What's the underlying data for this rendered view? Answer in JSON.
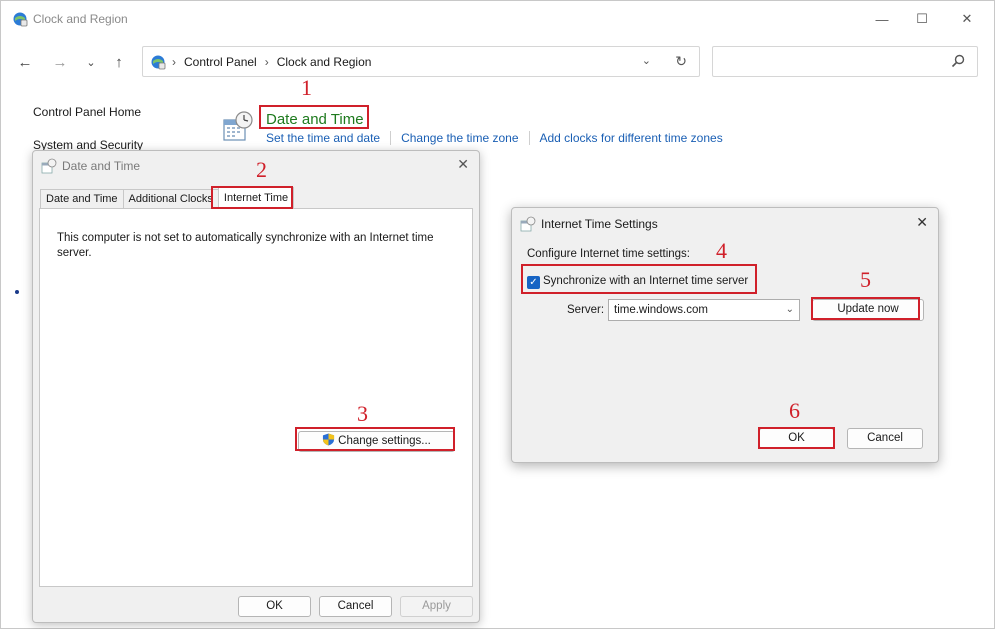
{
  "window": {
    "title": "Clock and Region",
    "controls": {
      "minimize": "—",
      "maximize": "☐",
      "close": "✕"
    }
  },
  "nav": {
    "back": "←",
    "forward": "→",
    "recent": "⌄",
    "up": "↑",
    "breadcrumbs": [
      "Control Panel",
      "Clock and Region"
    ],
    "separator": "›",
    "dropdown": "⌄",
    "refresh": "↻",
    "search_placeholder": ""
  },
  "sidebar": {
    "items": [
      {
        "label": "Control Panel Home"
      },
      {
        "label": "System and Security"
      }
    ]
  },
  "category": {
    "heading": "Date and Time",
    "links": [
      "Set the time and date",
      "Change the time zone",
      "Add clocks for different time zones"
    ]
  },
  "date_time_dialog": {
    "title": "Date and Time",
    "close": "✕",
    "tabs": [
      {
        "label": "Date and Time",
        "active": false
      },
      {
        "label": "Additional Clocks",
        "active": false
      },
      {
        "label": "Internet Time",
        "active": true
      }
    ],
    "message": "This computer is not set to automatically synchronize with an Internet time server.",
    "change_settings_label": "Change settings...",
    "ok_label": "OK",
    "cancel_label": "Cancel",
    "apply_label": "Apply"
  },
  "internet_time_dialog": {
    "title": "Internet Time Settings",
    "close": "✕",
    "configure_label": "Configure Internet time settings:",
    "sync_checked": true,
    "sync_label": "Synchronize with an Internet time server",
    "check_glyph": "✓",
    "server_label": "Server:",
    "server_value": "time.windows.com",
    "server_chevron": "⌄",
    "update_now_label": "Update now",
    "ok_label": "OK",
    "cancel_label": "Cancel"
  },
  "annotations": [
    "1",
    "2",
    "3",
    "4",
    "5",
    "6"
  ],
  "colors": {
    "annotation": "#d0202a",
    "link": "#1a5fb4",
    "heading_green": "#1e7a1e",
    "checkbox_blue": "#1664c4"
  }
}
